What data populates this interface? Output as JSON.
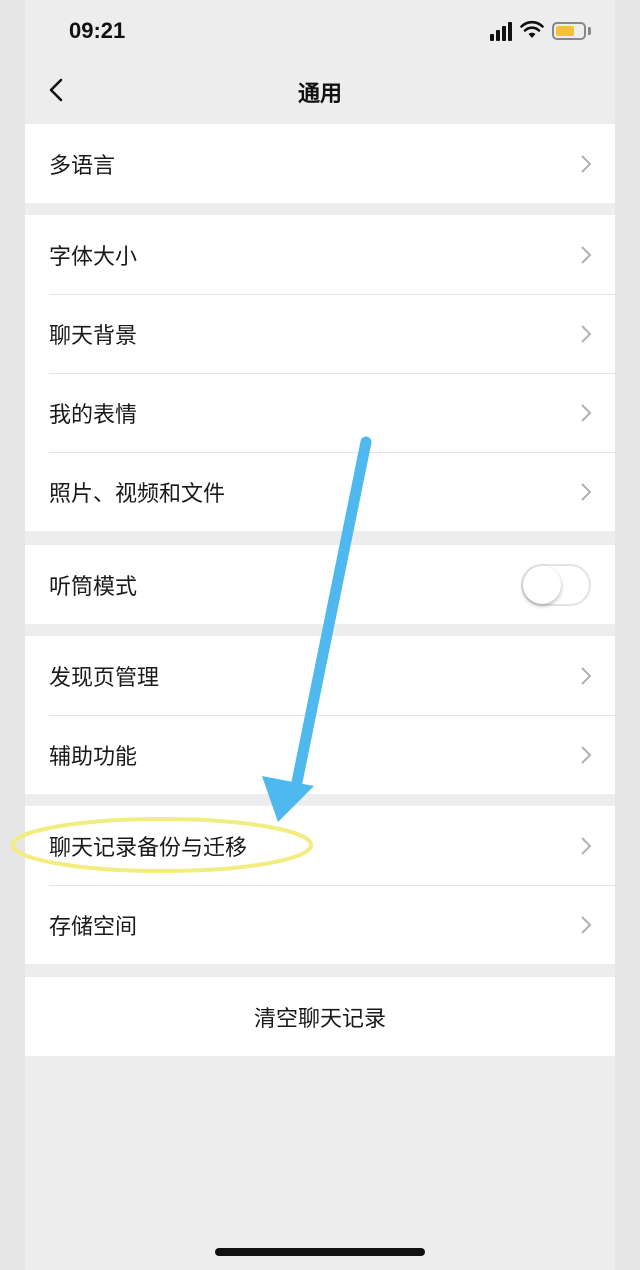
{
  "status_bar": {
    "time": "09:21",
    "battery_color": "#f2c230"
  },
  "nav": {
    "title": "通用",
    "back_icon": "chevron-left-icon"
  },
  "groups": [
    {
      "items": [
        {
          "label": "多语言"
        }
      ]
    },
    {
      "items": [
        {
          "label": "字体大小"
        },
        {
          "label": "聊天背景"
        },
        {
          "label": "我的表情"
        },
        {
          "label": "照片、视频和文件"
        }
      ]
    },
    {
      "items": [
        {
          "label": "听筒模式",
          "toggle": false
        }
      ]
    },
    {
      "items": [
        {
          "label": "发现页管理"
        },
        {
          "label": "辅助功能"
        }
      ]
    },
    {
      "items": [
        {
          "label": "聊天记录备份与迁移",
          "highlighted": true
        },
        {
          "label": "存储空间"
        }
      ]
    }
  ],
  "clear_button": {
    "label": "清空聊天记录"
  },
  "annotations": {
    "arrow_color": "#4fb8ee",
    "ellipse_color": "#f3ec7e"
  }
}
